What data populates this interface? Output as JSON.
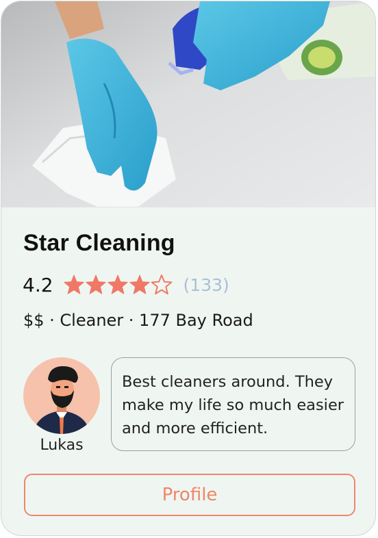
{
  "business": {
    "name": "Star Cleaning",
    "rating": "4.2",
    "stars_filled": 4,
    "stars_total": 5,
    "review_count": "(133)",
    "meta": "$$ · Cleaner · 177 Bay Road"
  },
  "review": {
    "reviewer_name": "Lukas",
    "text": "Best cleaners around. They make my life so much easier and more efficient."
  },
  "actions": {
    "profile_label": "Profile"
  },
  "colors": {
    "accent": "#f0856a",
    "star": "#f07866",
    "count": "#a9bfd6",
    "card_bg": "#eff6f2",
    "avatar_bg": "#f6c2ac"
  },
  "icons": {
    "star": "star-icon",
    "avatar": "person-avatar-icon"
  }
}
